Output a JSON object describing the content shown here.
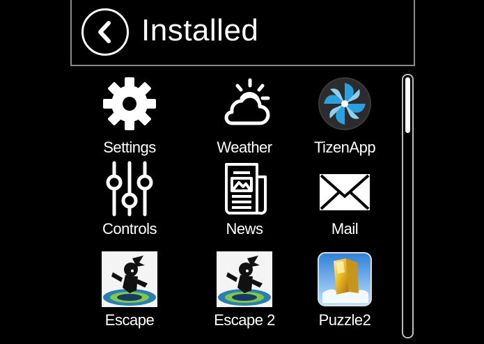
{
  "header": {
    "title": "Installed"
  },
  "apps": [
    {
      "label": "Settings",
      "icon": "gear-icon"
    },
    {
      "label": "Weather",
      "icon": "weather-icon"
    },
    {
      "label": "TizenApp",
      "icon": "tizen-icon"
    },
    {
      "label": "Controls",
      "icon": "sliders-icon"
    },
    {
      "label": "News",
      "icon": "newspaper-icon"
    },
    {
      "label": "Mail",
      "icon": "mail-icon"
    },
    {
      "label": "Escape",
      "icon": "escape-game-icon"
    },
    {
      "label": "Escape 2",
      "icon": "escape-game-icon"
    },
    {
      "label": "Puzzle2",
      "icon": "puzzle-icon"
    }
  ],
  "colors": {
    "background": "#000000",
    "border": "#8a8a8a",
    "tizen_accent": "#2aa0e0",
    "puzzle_gold": "#e8b820"
  }
}
